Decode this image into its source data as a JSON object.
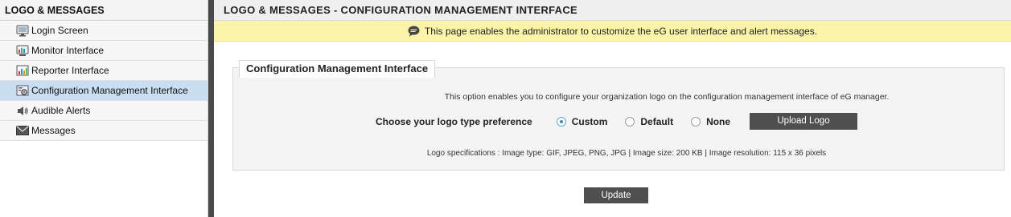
{
  "sidebar": {
    "title": "LOGO & MESSAGES",
    "items": [
      {
        "label": "Login Screen",
        "icon": "monitor-icon"
      },
      {
        "label": "Monitor Interface",
        "icon": "monitor-chart-icon"
      },
      {
        "label": "Reporter Interface",
        "icon": "report-icon"
      },
      {
        "label": "Configuration Management Interface",
        "icon": "config-gear-icon",
        "active": true
      },
      {
        "label": "Audible Alerts",
        "icon": "audio-alert-icon"
      },
      {
        "label": "Messages",
        "icon": "envelope-icon"
      }
    ]
  },
  "main": {
    "title": "LOGO & MESSAGES - CONFIGURATION MANAGEMENT INTERFACE",
    "banner": "This page enables the administrator to customize the eG user interface and alert messages.",
    "panel": {
      "legend": "Configuration Management Interface",
      "description": "This option enables you to configure your organization logo on the configuration management interface of eG manager.",
      "pref_label": "Choose your logo type preference",
      "options": [
        "Custom",
        "Default",
        "None"
      ],
      "selected": "Custom",
      "upload_label": "Upload Logo",
      "spec": "Logo specifications : Image type: GIF, JPEG, PNG, JPG | Image size: 200 KB | Image resolution: 115 x 36 pixels"
    },
    "update_label": "Update"
  },
  "colors": {
    "active_item": "#c9def0",
    "banner_bg": "#fbf4a9",
    "button_bg": "#4f4f4f",
    "divider": "#4a4a4a"
  }
}
